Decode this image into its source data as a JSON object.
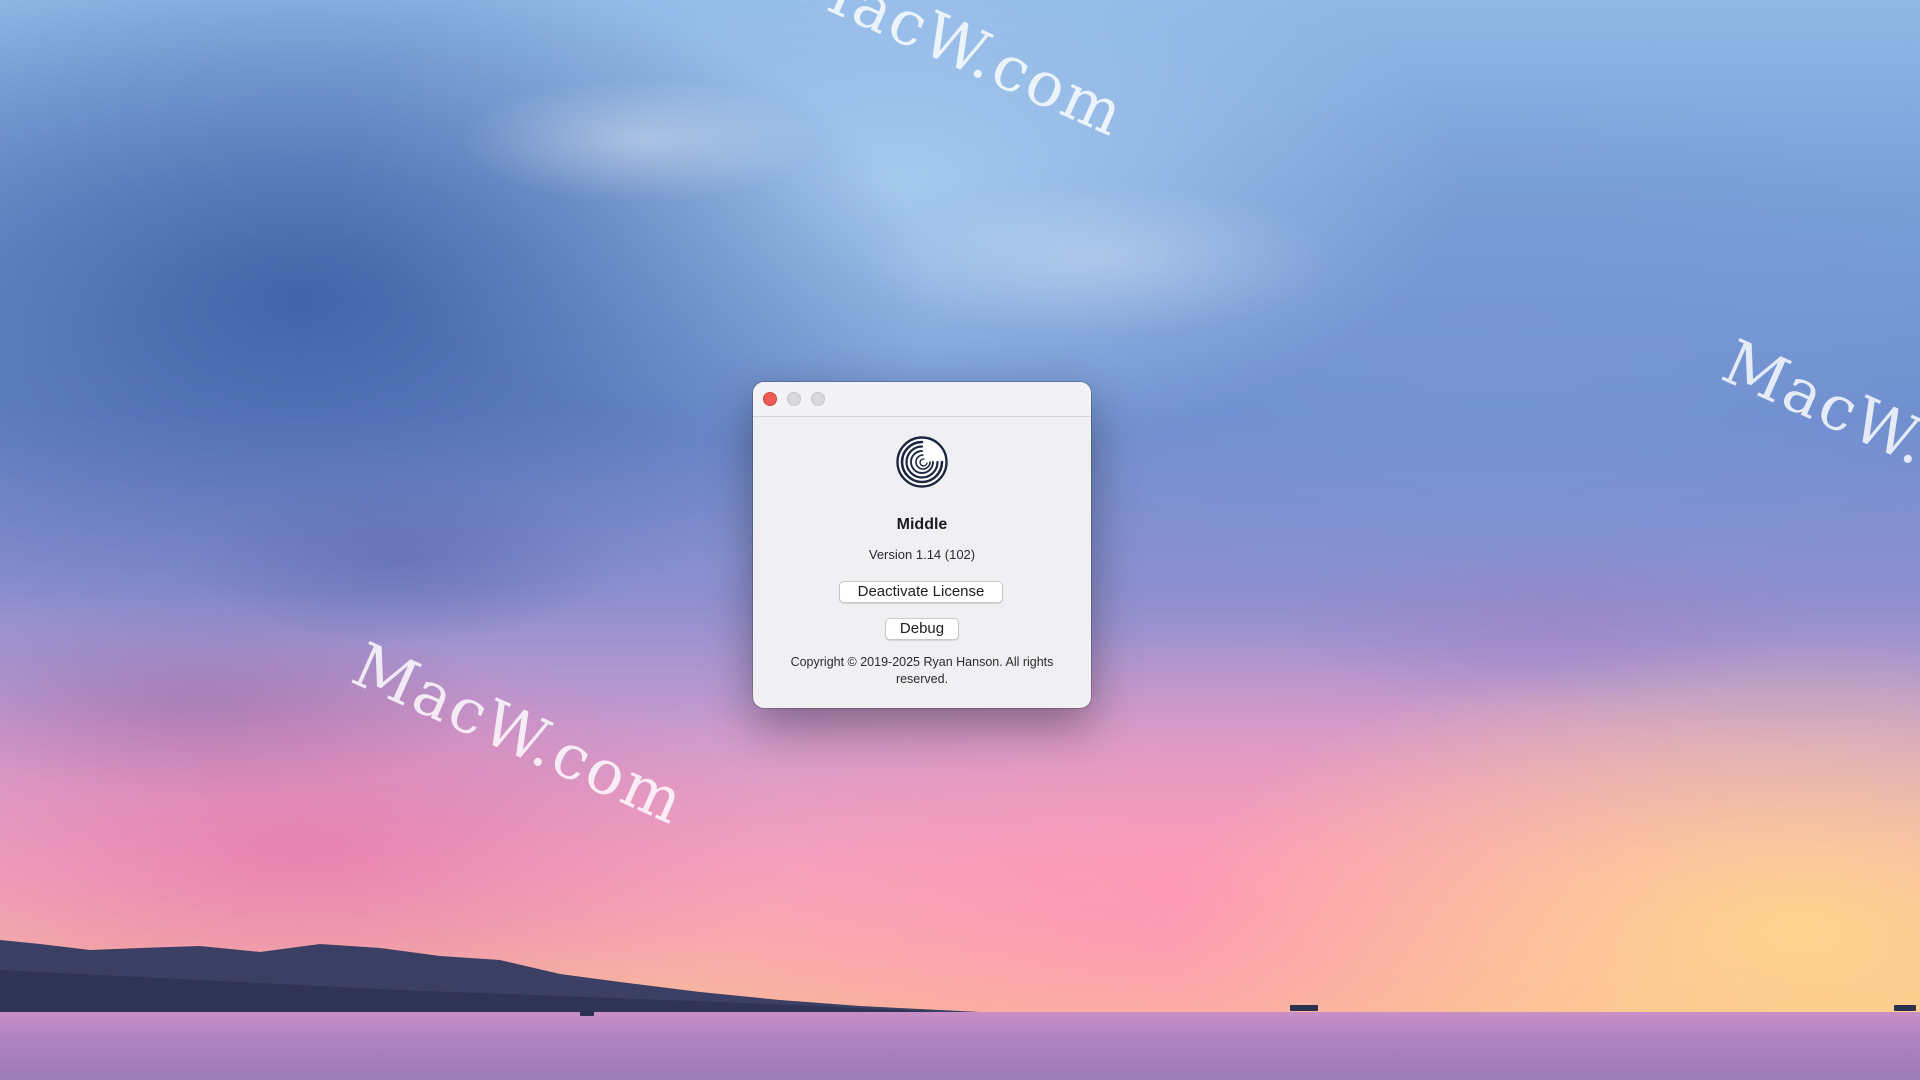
{
  "wallpaper": {
    "watermark_text": "MacW.com"
  },
  "about_window": {
    "app_name": "Middle",
    "version": "Version 1.14 (102)",
    "deactivate_button_label": "Deactivate License",
    "debug_button_label": "Debug",
    "copyright": "Copyright © 2019-2025 Ryan Hanson. All rights reserved.",
    "traffic_light_close_color": "#ee5b52",
    "traffic_light_inactive_color": "#d9d9dc"
  }
}
